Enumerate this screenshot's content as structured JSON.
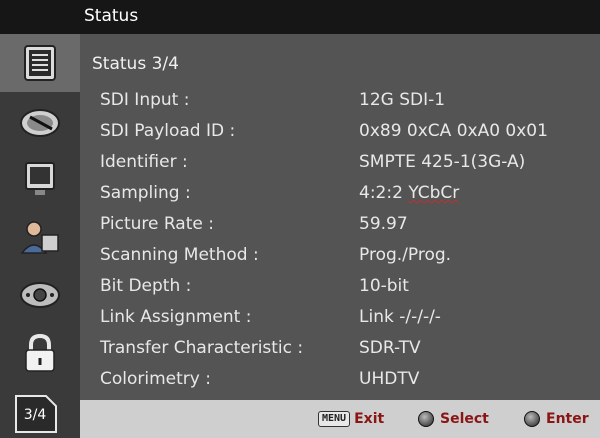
{
  "window": {
    "title": "Status"
  },
  "page": {
    "heading": "Status 3/4",
    "badge": "3/4"
  },
  "rows": [
    {
      "label": "SDI Input :",
      "value": "12G SDI-1"
    },
    {
      "label": "SDI Payload ID :",
      "value": "0x89 0xCA 0xA0 0x01"
    },
    {
      "label": "Identifier :",
      "value": "SMPTE 425-1(3G-A)"
    },
    {
      "label": "Sampling :",
      "value": "4:2:2 YCbCr"
    },
    {
      "label": "Picture Rate :",
      "value": "59.97"
    },
    {
      "label": "Scanning Method :",
      "value": "Prog./Prog."
    },
    {
      "label": "Bit Depth :",
      "value": "10-bit"
    },
    {
      "label": "Link Assignment :",
      "value": "Link -/-/-/-"
    },
    {
      "label": "Transfer Characteristic :",
      "value": "SDR-TV"
    },
    {
      "label": "Colorimetry :",
      "value": "UHDTV"
    }
  ],
  "footer": {
    "menu_key": "MENU",
    "exit_label": "Exit",
    "select_label": "Select",
    "enter_label": "Enter"
  },
  "sidebar": {
    "items": [
      {
        "icon": "status-icon",
        "active": true
      },
      {
        "icon": "gauge-icon"
      },
      {
        "icon": "monitor-icon"
      },
      {
        "icon": "user-icon"
      },
      {
        "icon": "joystick-icon"
      },
      {
        "icon": "lock-icon"
      }
    ]
  },
  "colors": {
    "background": "#545454",
    "title_bar": "#161616",
    "sidebar": "#3a3a3a",
    "footer": "#cfcfcf",
    "footer_text": "#8a1515"
  }
}
